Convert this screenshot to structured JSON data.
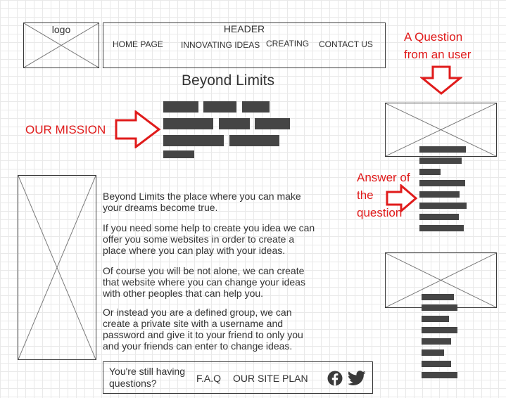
{
  "logo": {
    "label": "logo"
  },
  "header": {
    "title": "HEADER",
    "nav": [
      {
        "label": "HOME PAGE"
      },
      {
        "label": "INNOVATING IDEAS"
      },
      {
        "label": "CREATING"
      },
      {
        "label": "CONTACT US"
      }
    ]
  },
  "page_title": "Beyond Limits",
  "mission": {
    "label": "OUR MISSION"
  },
  "question": {
    "lines": [
      "A Question",
      "from an user"
    ]
  },
  "answer": {
    "lines": [
      "Answer of",
      "the",
      "question"
    ]
  },
  "body": {
    "paragraphs": [
      "Beyond Limits the place where you can make your dreams become true.",
      "If you need some help to create you idea we can offer you some websites in order to create a place where you can play with your ideas.",
      "Of course you will be not alone, we can create that website where you can change your ideas with other peoples that can help you.",
      "Or instead you are a defined group, we can create a private site with a username and password and give it to your friend to only you and your friends can enter to change ideas."
    ]
  },
  "footer": {
    "still_questions": "You're still having questions?",
    "faq": "F.A.Q",
    "site_plan": "OUR SITE PLAN",
    "icons": [
      "facebook-icon",
      "twitter-icon"
    ]
  },
  "colors": {
    "annotation_red": "#e01b1b",
    "placeholder_bar": "#454545",
    "outline": "#3a3a3a",
    "grid": "#e9e9e9"
  }
}
